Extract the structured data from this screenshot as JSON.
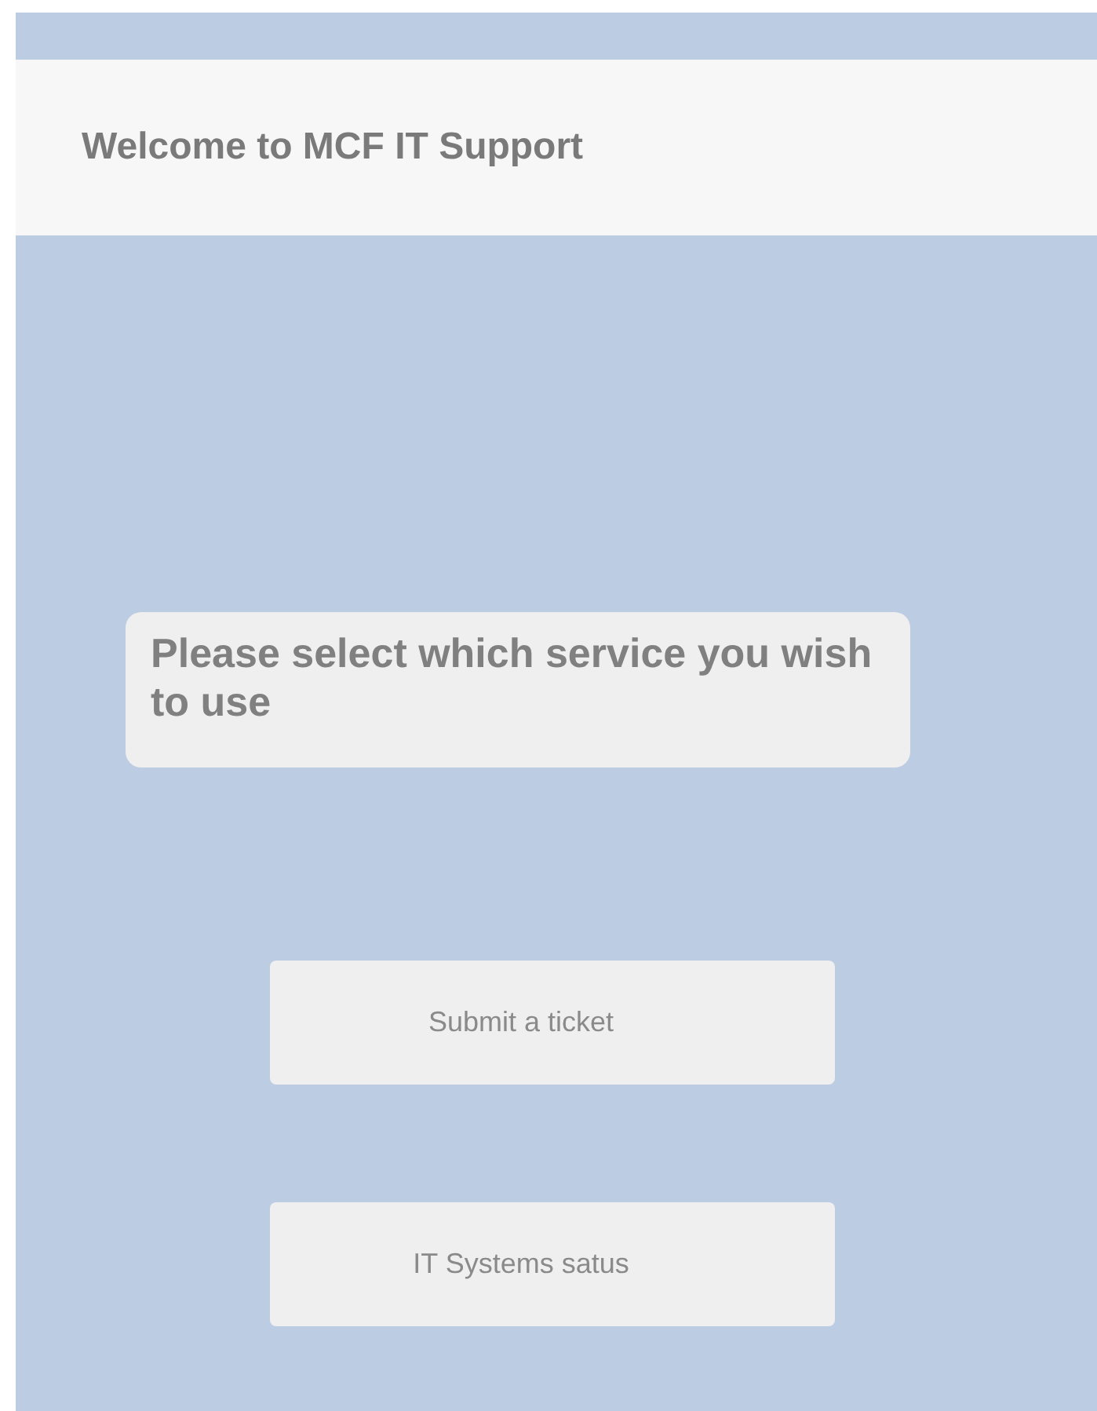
{
  "header": {
    "title": "Welcome to MCF IT Support"
  },
  "prompt": "Please select which service you wish to use",
  "buttons": [
    "Submit a ticket",
    "IT Systems satus"
  ]
}
